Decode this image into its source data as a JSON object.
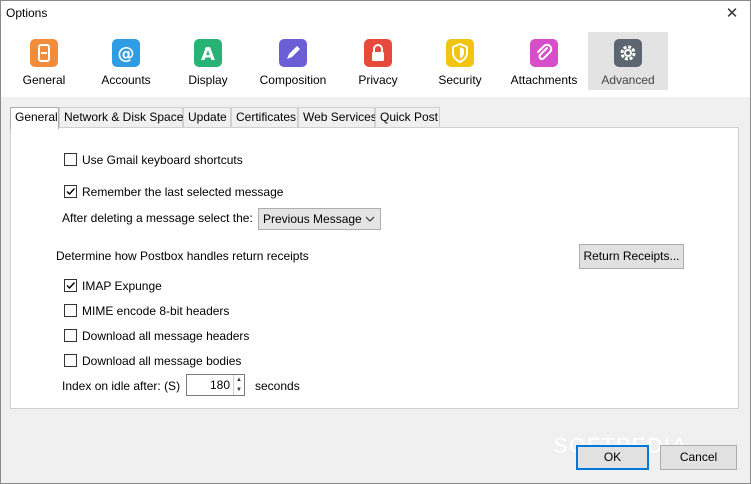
{
  "window": {
    "title": "Options",
    "close_glyph": "✕"
  },
  "toolbar": {
    "items": [
      {
        "label": "General",
        "icon": "general-icon",
        "color": "#f08c3a",
        "glyph": "▯",
        "selected": false
      },
      {
        "label": "Accounts",
        "icon": "accounts-icon",
        "color": "#2f9de4",
        "glyph": "@",
        "selected": false
      },
      {
        "label": "Display",
        "icon": "display-icon",
        "color": "#27b376",
        "glyph": "A",
        "selected": false
      },
      {
        "label": "Composition",
        "icon": "composition-icon",
        "color": "#6c5fd6",
        "glyph": "✎",
        "selected": false
      },
      {
        "label": "Privacy",
        "icon": "privacy-icon",
        "color": "#e64a3b",
        "glyph": "⬚",
        "selected": false
      },
      {
        "label": "Security",
        "icon": "security-icon",
        "color": "#f1c40f",
        "glyph": "!",
        "selected": false
      },
      {
        "label": "Attachments",
        "icon": "attachments-icon",
        "color": "#d64fc9",
        "glyph": "⌁",
        "selected": false
      },
      {
        "label": "Advanced",
        "icon": "advanced-icon",
        "color": "#5d6670",
        "glyph": "⚙",
        "selected": true
      }
    ]
  },
  "tabs": [
    {
      "label": "General",
      "active": true
    },
    {
      "label": "Network & Disk Space",
      "active": false
    },
    {
      "label": "Update",
      "active": false
    },
    {
      "label": "Certificates",
      "active": false
    },
    {
      "label": "Web Services",
      "active": false
    },
    {
      "label": "Quick Post",
      "active": false
    }
  ],
  "general": {
    "gmail_shortcuts": {
      "label": "Use Gmail keyboard shortcuts",
      "checked": false
    },
    "remember_last": {
      "label": "Remember the last selected message",
      "checked": true
    },
    "after_delete_label": "After deleting a message select the:",
    "after_delete_value": "Previous Message",
    "receipts_label": "Determine how Postbox handles return receipts",
    "receipts_button": "Return Receipts...",
    "imap_expunge": {
      "label": "IMAP Expunge",
      "checked": true
    },
    "mime_encode": {
      "label": "MIME encode 8-bit headers",
      "checked": false
    },
    "download_headers": {
      "label": "Download all message headers",
      "checked": false
    },
    "download_bodies": {
      "label": "Download all message bodies",
      "checked": false
    },
    "index_idle_label": "Index on idle after: (S)",
    "index_idle_value": "180",
    "index_idle_unit": "seconds"
  },
  "footer": {
    "ok_label": "OK",
    "cancel_label": "Cancel"
  },
  "watermark": "SOFTPEDIA"
}
